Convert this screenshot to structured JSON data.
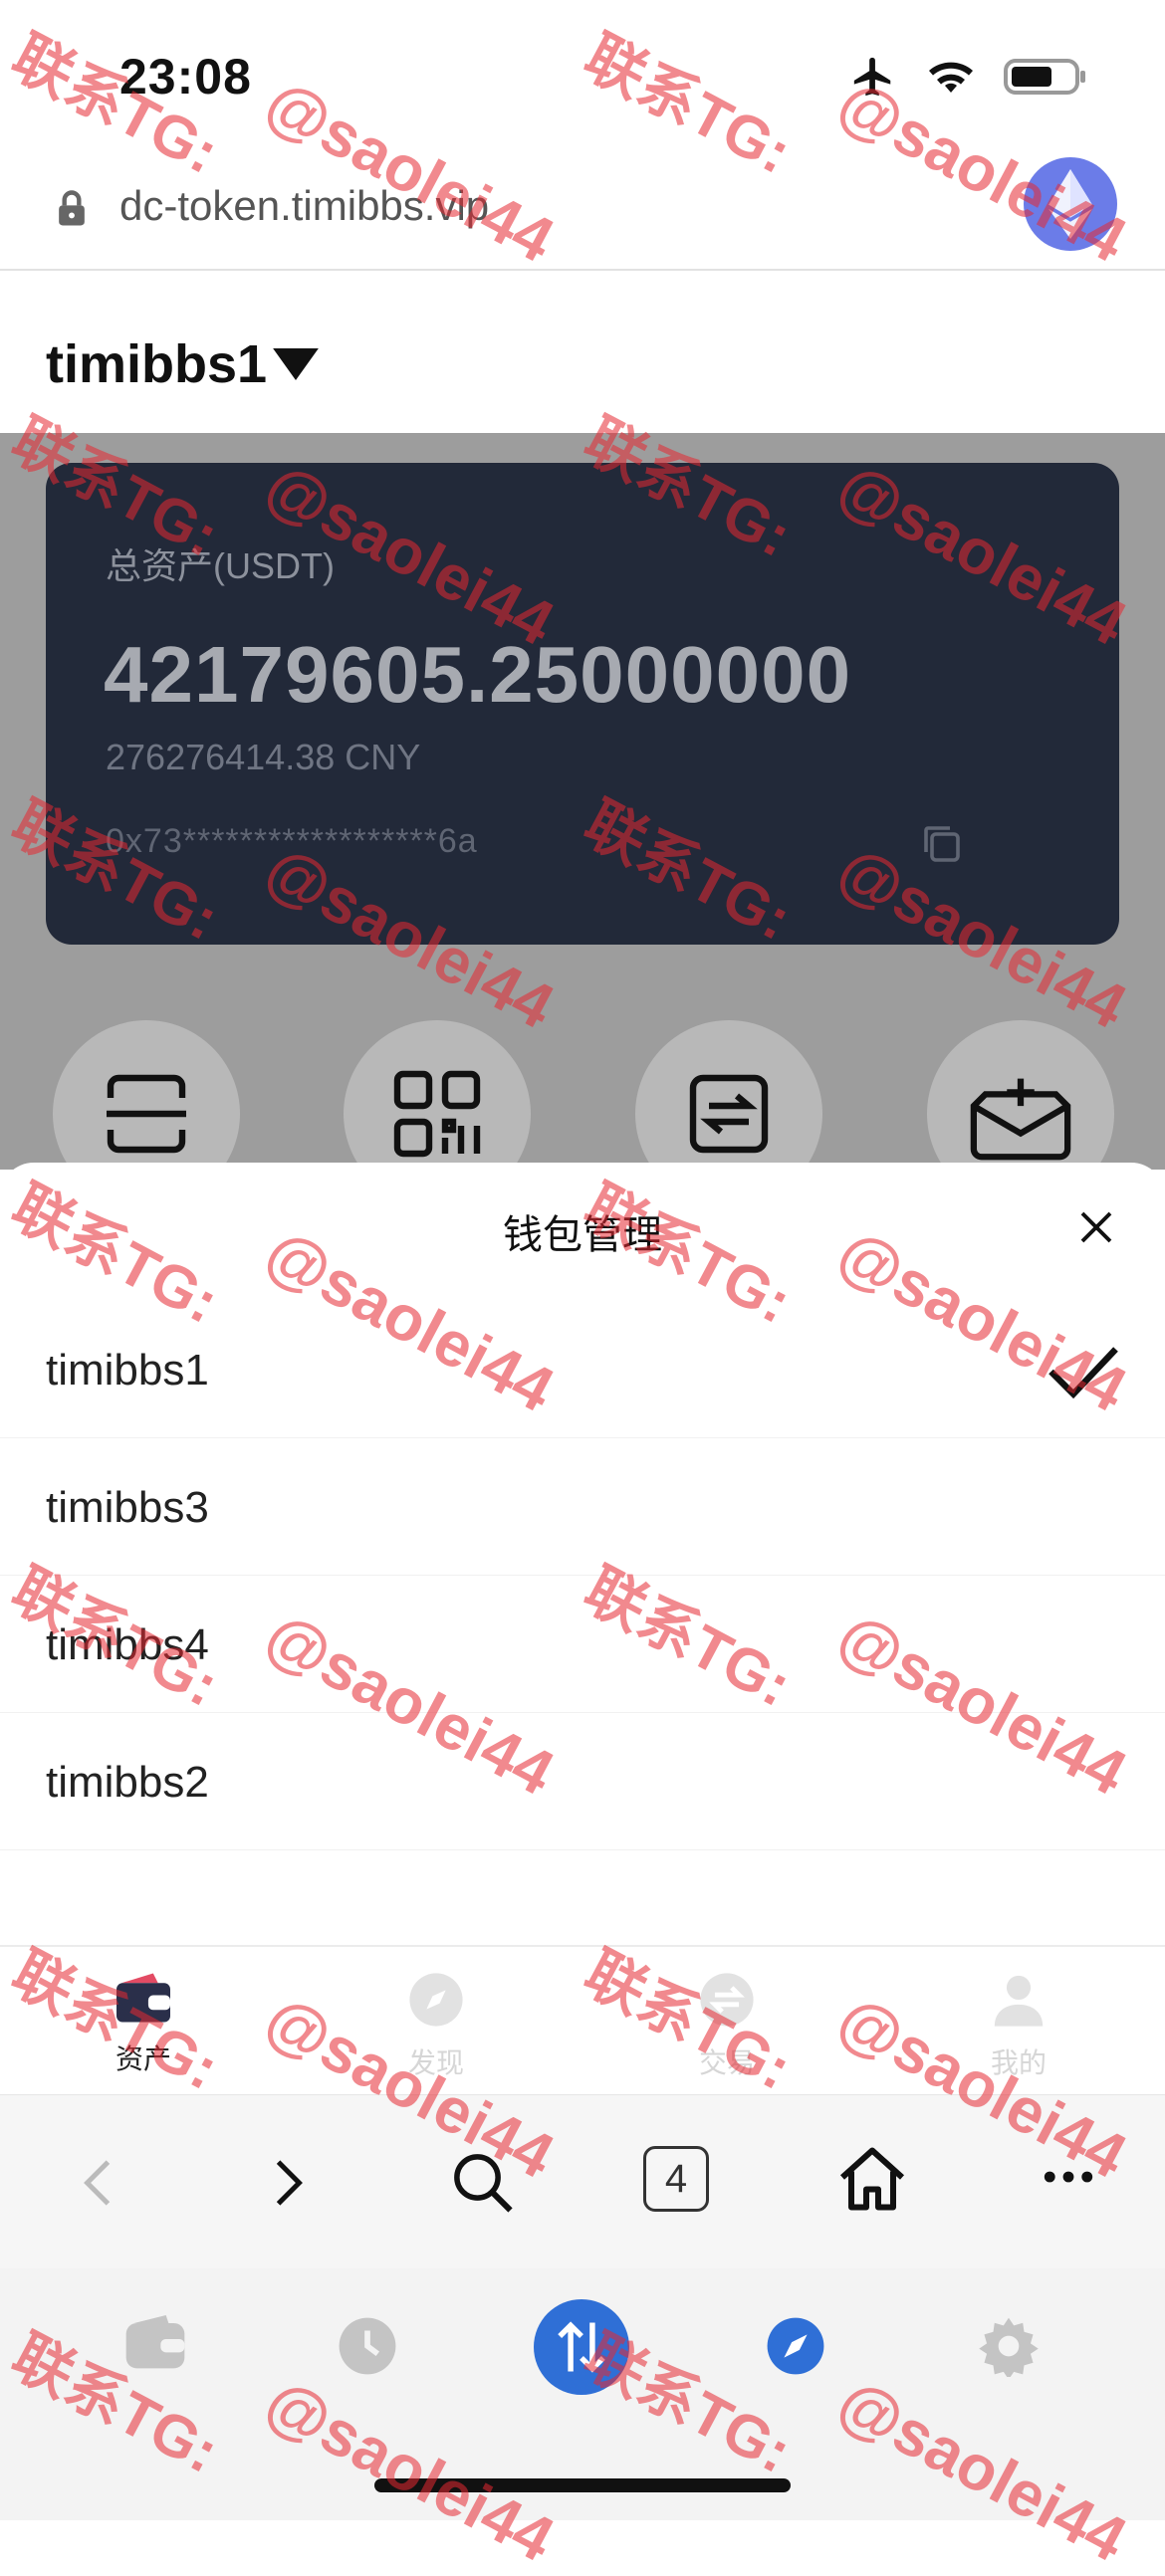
{
  "status_bar": {
    "time": "23:08"
  },
  "browser": {
    "url": "dc-token.timibbs.vip",
    "tab_count": "4"
  },
  "wallet": {
    "name": "timibbs1",
    "total_label": "总资产(USDT)",
    "total_value": "42179605.25000000",
    "cny_value": "276276414.38 CNY",
    "address": "0x73******************6a"
  },
  "sheet": {
    "title": "钱包管理",
    "wallets": [
      "timibbs1",
      "timibbs3",
      "timibbs4",
      "timibbs2"
    ],
    "selected": "timibbs1"
  },
  "tabs": [
    {
      "label": "资产",
      "icon": "wallet-icon"
    },
    {
      "label": "发现",
      "icon": "compass-icon"
    },
    {
      "label": "交易",
      "icon": "exchange-icon"
    },
    {
      "label": "我的",
      "icon": "user-icon"
    }
  ],
  "watermark": {
    "line1": "联系TG:",
    "line2": "@saolei44"
  },
  "colors": {
    "card": "#222939",
    "accent": "#2f6fd6",
    "eth": "#6b7ce8",
    "watermark": "#e62832"
  }
}
